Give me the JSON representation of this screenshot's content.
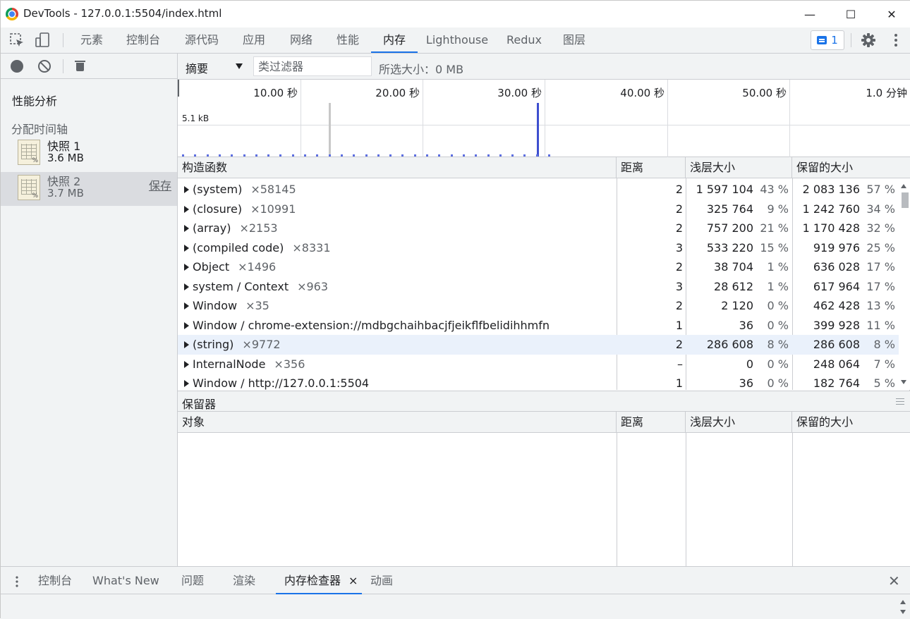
{
  "window": {
    "title": "DevTools - 127.0.0.1:5504/index.html",
    "minimize": "—",
    "maximize": "☐",
    "close": "✕"
  },
  "tabs": {
    "items": [
      "元素",
      "控制台",
      "源代码",
      "应用",
      "网络",
      "性能",
      "内存",
      "Lighthouse",
      "Redux",
      "图层"
    ],
    "active": "内存",
    "issues_count": "1"
  },
  "sidebar": {
    "heading": "性能分析",
    "section": "分配时间轴",
    "snapshots": [
      {
        "name": "快照 1",
        "size": "3.6 MB"
      },
      {
        "name": "快照 2",
        "size": "3.7 MB",
        "save": "保存"
      }
    ]
  },
  "toolbar": {
    "view": "摘要",
    "filter_placeholder": "类过滤器",
    "selected_size": "所选大小：0 MB"
  },
  "overview": {
    "time_labels": [
      "10.00 秒",
      "20.00 秒",
      "30.00 秒",
      "40.00 秒",
      "50.00 秒",
      "1.0 分钟"
    ],
    "kb_label": "5.1 kB",
    "bar_colors": {
      "inactive": "#c8c8c8",
      "active": "#3d4fcf"
    }
  },
  "table": {
    "headers": {
      "constructor": "构造函数",
      "distance": "距离",
      "shallow": "浅层大小",
      "retained": "保留的大小"
    },
    "rows": [
      {
        "name": "(system)",
        "count": "×58145",
        "distance": "2",
        "shallow": "1 597 104",
        "shallow_pct": "43 %",
        "retained": "2 083 136",
        "retained_pct": "57 %"
      },
      {
        "name": "(closure)",
        "count": "×10991",
        "distance": "2",
        "shallow": "325 764",
        "shallow_pct": "9 %",
        "retained": "1 242 760",
        "retained_pct": "34 %"
      },
      {
        "name": "(array)",
        "count": "×2153",
        "distance": "2",
        "shallow": "757 200",
        "shallow_pct": "21 %",
        "retained": "1 170 428",
        "retained_pct": "32 %"
      },
      {
        "name": "(compiled code)",
        "count": "×8331",
        "distance": "3",
        "shallow": "533 220",
        "shallow_pct": "15 %",
        "retained": "919 976",
        "retained_pct": "25 %"
      },
      {
        "name": "Object",
        "count": "×1496",
        "distance": "2",
        "shallow": "38 704",
        "shallow_pct": "1 %",
        "retained": "636 028",
        "retained_pct": "17 %"
      },
      {
        "name": "system / Context",
        "count": "×963",
        "distance": "3",
        "shallow": "28 612",
        "shallow_pct": "1 %",
        "retained": "617 964",
        "retained_pct": "17 %"
      },
      {
        "name": "Window",
        "count": "×35",
        "distance": "2",
        "shallow": "2 120",
        "shallow_pct": "0 %",
        "retained": "462 428",
        "retained_pct": "13 %"
      },
      {
        "name": "Window / chrome-extension://mdbgchaihbacjfjeikflfbelidihhmfn",
        "count": "",
        "distance": "1",
        "shallow": "36",
        "shallow_pct": "0 %",
        "retained": "399 928",
        "retained_pct": "11 %"
      },
      {
        "name": "(string)",
        "count": "×9772",
        "distance": "2",
        "shallow": "286 608",
        "shallow_pct": "8 %",
        "retained": "286 608",
        "retained_pct": "8 %",
        "highlight": true
      },
      {
        "name": "InternalNode",
        "count": "×356",
        "distance": "–",
        "shallow": "0",
        "shallow_pct": "0 %",
        "retained": "248 064",
        "retained_pct": "7 %"
      },
      {
        "name": "Window / http://127.0.0.1:5504",
        "count": "",
        "distance": "1",
        "shallow": "36",
        "shallow_pct": "0 %",
        "retained": "182 764",
        "retained_pct": "5 %"
      }
    ]
  },
  "retainers": {
    "title": "保留器",
    "headers": {
      "object": "对象",
      "distance": "距离",
      "shallow": "浅层大小",
      "retained": "保留的大小"
    }
  },
  "drawer": {
    "tabs": [
      "控制台",
      "What's New",
      "问题",
      "渲染",
      "内存检查器",
      "动画"
    ],
    "active": "内存检查器",
    "tab_close": "×",
    "close": "✕"
  }
}
